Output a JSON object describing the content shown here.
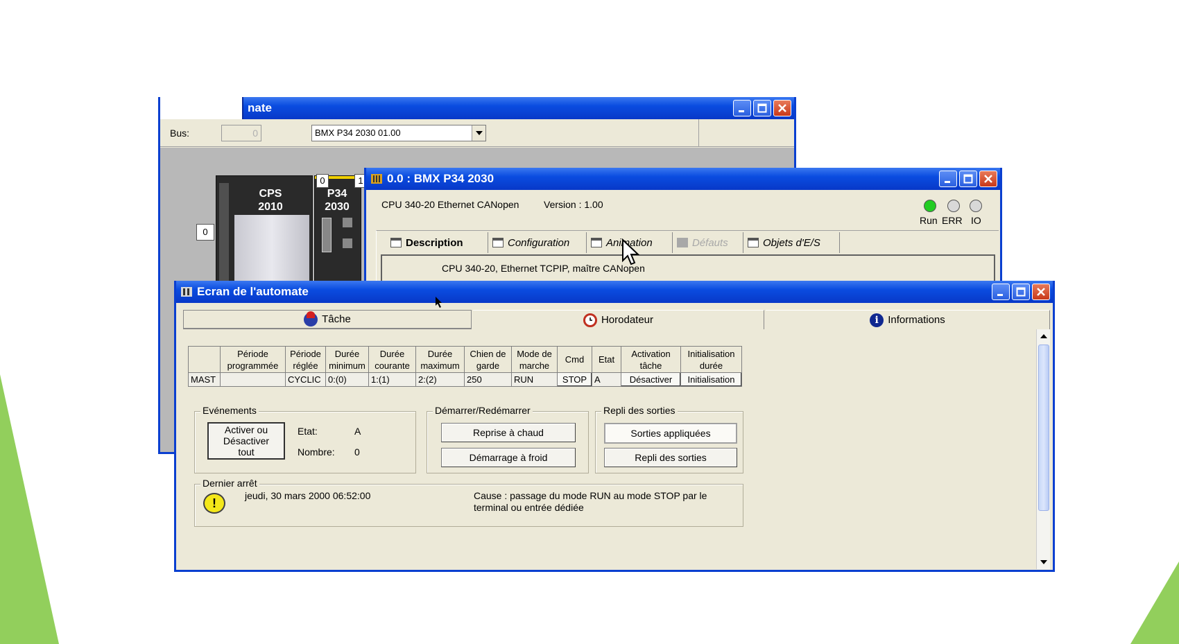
{
  "colors": {
    "titlebar": "#0a4ce0",
    "window_bg": "#ece9d8",
    "green_accent": "#92cf5c",
    "run_led": "#22cc22"
  },
  "win_rack": {
    "title": "nate",
    "bus_label": "Bus:",
    "bus_value": "0",
    "processor_select": "BMX P34 2030   01.00",
    "slot_left": "0",
    "slot_cpu": "0",
    "slot_next": "1",
    "module1": "CPS\n2010",
    "module2": "P34\n2030"
  },
  "win_cpu": {
    "title": "0.0 : BMX P34 2030",
    "header": "CPU 340-20 Ethernet CANopen",
    "version": "Version : 1.00",
    "leds": [
      "Run",
      "ERR",
      "IO"
    ],
    "tabs": [
      "Description",
      "Configuration",
      "Animation",
      "Défauts",
      "Objets d'E/S"
    ],
    "description": "CPU 340-20, Ethernet TCPIP, maître CANopen"
  },
  "win_screen": {
    "title": "Ecran de l'automate",
    "tabs": [
      "Tâche",
      "Horodateur",
      "Informations"
    ],
    "task_table": {
      "headers": [
        "",
        "Période\nprogrammée",
        "Période\nréglée",
        "Durée\nminimum",
        "Durée\ncourante",
        "Durée\nmaximum",
        "Chien de\ngarde",
        "Mode de\nmarche",
        "Cmd",
        "Etat",
        "Activation\ntâche",
        "Initialisation\ndurée"
      ],
      "row": [
        "MAST",
        "",
        "CYCLIC",
        "0:(0)",
        "1:(1)",
        "2:(2)",
        "250",
        "RUN",
        "STOP",
        "A",
        "Désactiver",
        "Initialisation"
      ]
    },
    "events": {
      "label": "Evénements",
      "button": "Activer ou\nDésactiver\ntout",
      "etat_label": "Etat:",
      "etat_value": "A",
      "nombre_label": "Nombre:",
      "nombre_value": "0"
    },
    "restart": {
      "label": "Démarrer/Redémarrer",
      "warm": "Reprise à chaud",
      "cold": "Démarrage à froid"
    },
    "fallback": {
      "label": "Repli des sorties",
      "applied": "Sorties appliquées",
      "fallback": "Repli des sorties"
    },
    "last_stop": {
      "label": "Dernier arrêt",
      "date": "jeudi, 30 mars 2000 06:52:00",
      "cause": "Cause : passage du mode RUN au mode STOP par le\nterminal ou entrée dédiée"
    }
  }
}
